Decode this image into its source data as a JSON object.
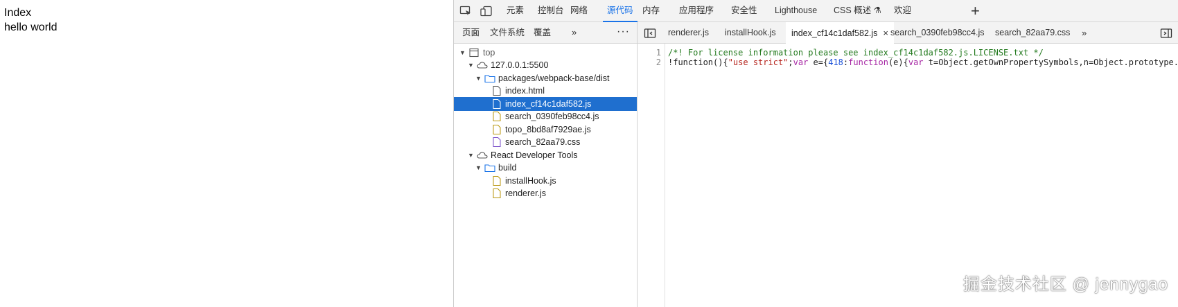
{
  "page": {
    "title": "Index",
    "text": "hello world"
  },
  "devtools": {
    "main_tabs": [
      "元素",
      "控制台",
      "网络",
      "源代码",
      "内存",
      "应用程序",
      "安全性",
      "Lighthouse",
      "CSS 概述 ⚗",
      "欢迎"
    ],
    "navigator": {
      "tabs": [
        "页面",
        "文件系统",
        "覆盖"
      ],
      "more": "»",
      "kebab": "⋮",
      "tree": [
        {
          "label": "top"
        },
        {
          "label": "127.0.0.1:5500"
        },
        {
          "label": "packages/webpack-base/dist"
        },
        {
          "label": "index.html"
        },
        {
          "label": "index_cf14c1daf582.js",
          "selected": true
        },
        {
          "label": "search_0390feb98cc4.js"
        },
        {
          "label": "topo_8bd8af7929ae.js"
        },
        {
          "label": "search_82aa79.css"
        },
        {
          "label": "React Developer Tools"
        },
        {
          "label": "build"
        },
        {
          "label": "installHook.js"
        },
        {
          "label": "renderer.js"
        }
      ]
    },
    "editor": {
      "tabs": [
        "renderer.js",
        "installHook.js",
        "index_cf14c1daf582.js",
        "search_0390feb98cc4.js",
        "search_82aa79.css"
      ],
      "active_tab": "index_cf14c1daf582.js",
      "close_glyph": "×",
      "line_numbers": [
        "1",
        "2"
      ],
      "line1": "/*! For license information please see index_cf14c1daf582.js.LICENSE.txt */",
      "line2": {
        "t1": "!function(){",
        "t2": "\"use strict\"",
        "t3": ";",
        "t4": "var",
        "t5": " e={",
        "t6": "418",
        "t7": ":",
        "t8": "function",
        "t9": "(e){",
        "t10": "var",
        "t11": " t=Object.getOwnPropertySymbols,n=Object.prototype."
      }
    }
  },
  "watermark": "掘金技术社区 @ jennygao",
  "colors": {
    "accent": "#1a73e8",
    "selection": "#1f6fcf",
    "toolbar_bg": "#f3f3f3"
  }
}
